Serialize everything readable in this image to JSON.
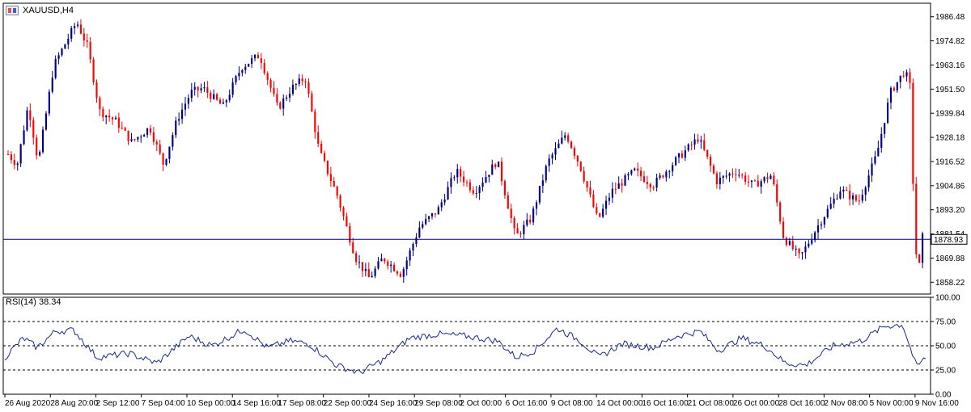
{
  "window": {
    "symbol_label": "XAUUSD,H4",
    "icon": "chart-window-icon"
  },
  "colors": {
    "bull": "#000080",
    "bear": "#ff0000",
    "rsi_line": "#1a2a8c",
    "level_line": "#000000",
    "frame": "#000000"
  },
  "chart_data": [
    {
      "type": "candlestick",
      "title": "XAUUSD,H4",
      "x_tick_labels": [
        "26 Aug 2020",
        "28 Aug 20:00",
        "2 Sep 12:00",
        "7 Sep 04:00",
        "10 Sep 00:00",
        "14 Sep 16:00",
        "17 Sep 08:00",
        "22 Sep 00:00",
        "24 Sep 16:00",
        "29 Sep 08:00",
        "2 Oct 00:00",
        "6 Oct 16:00",
        "9 Oct 08:00",
        "14 Oct 00:00",
        "16 Oct 16:00",
        "21 Oct 08:00",
        "26 Oct 00:00",
        "28 Oct 16:00",
        "2 Nov 08:00",
        "5 Nov 00:00",
        "9 Nov 16:00"
      ],
      "y_tick_labels": [
        "1986.48",
        "1974.82",
        "1963.16",
        "1951.50",
        "1939.84",
        "1928.18",
        "1916.52",
        "1904.86",
        "1893.20",
        "1881.54",
        "1869.88",
        "1858.22"
      ],
      "ylim": [
        1852.5,
        1993.0
      ],
      "current_price": 1878.93,
      "current_price_label": "1878.93",
      "anchors": [
        {
          "x": 0.0,
          "price": 1920
        },
        {
          "x": 0.01,
          "price": 1915
        },
        {
          "x": 0.022,
          "price": 1944
        },
        {
          "x": 0.033,
          "price": 1916
        },
        {
          "x": 0.05,
          "price": 1963
        },
        {
          "x": 0.075,
          "price": 1984
        },
        {
          "x": 0.087,
          "price": 1972
        },
        {
          "x": 0.1,
          "price": 1941
        },
        {
          "x": 0.118,
          "price": 1936
        },
        {
          "x": 0.135,
          "price": 1926
        },
        {
          "x": 0.155,
          "price": 1933
        },
        {
          "x": 0.17,
          "price": 1915
        },
        {
          "x": 0.185,
          "price": 1937
        },
        {
          "x": 0.2,
          "price": 1950
        },
        {
          "x": 0.213,
          "price": 1952
        },
        {
          "x": 0.235,
          "price": 1943
        },
        {
          "x": 0.255,
          "price": 1962
        },
        {
          "x": 0.275,
          "price": 1968
        },
        {
          "x": 0.295,
          "price": 1942
        },
        {
          "x": 0.31,
          "price": 1952
        },
        {
          "x": 0.325,
          "price": 1957
        },
        {
          "x": 0.34,
          "price": 1922
        },
        {
          "x": 0.36,
          "price": 1900
        },
        {
          "x": 0.38,
          "price": 1870
        },
        {
          "x": 0.395,
          "price": 1860
        },
        {
          "x": 0.41,
          "price": 1870
        },
        {
          "x": 0.43,
          "price": 1862
        },
        {
          "x": 0.45,
          "price": 1885
        },
        {
          "x": 0.47,
          "price": 1893
        },
        {
          "x": 0.49,
          "price": 1912
        },
        {
          "x": 0.51,
          "price": 1902
        },
        {
          "x": 0.535,
          "price": 1917
        },
        {
          "x": 0.555,
          "price": 1880
        },
        {
          "x": 0.572,
          "price": 1889
        },
        {
          "x": 0.59,
          "price": 1916
        },
        {
          "x": 0.61,
          "price": 1930
        },
        {
          "x": 0.625,
          "price": 1915
        },
        {
          "x": 0.645,
          "price": 1888
        },
        {
          "x": 0.66,
          "price": 1902
        },
        {
          "x": 0.685,
          "price": 1912
        },
        {
          "x": 0.705,
          "price": 1905
        },
        {
          "x": 0.73,
          "price": 1917
        },
        {
          "x": 0.755,
          "price": 1928
        },
        {
          "x": 0.775,
          "price": 1907
        },
        {
          "x": 0.795,
          "price": 1912
        },
        {
          "x": 0.815,
          "price": 1905
        },
        {
          "x": 0.835,
          "price": 1910
        },
        {
          "x": 0.848,
          "price": 1880
        },
        {
          "x": 0.866,
          "price": 1870
        },
        {
          "x": 0.885,
          "price": 1885
        },
        {
          "x": 0.91,
          "price": 1903
        },
        {
          "x": 0.93,
          "price": 1897
        },
        {
          "x": 0.95,
          "price": 1920
        },
        {
          "x": 0.965,
          "price": 1950
        },
        {
          "x": 0.98,
          "price": 1960
        },
        {
          "x": 0.986,
          "price": 1955
        },
        {
          "x": 0.992,
          "price": 1875
        },
        {
          "x": 0.996,
          "price": 1864
        },
        {
          "x": 1.0,
          "price": 1880
        }
      ],
      "indicator": {
        "name": "RSI(14)",
        "label": "RSI(14) 38.34",
        "last_value": 38.34,
        "y_tick_labels": [
          "100.00",
          "75.00",
          "50.00",
          "25.00",
          "0.00"
        ],
        "ylim": [
          0,
          100
        ],
        "levels": [
          75,
          50,
          25
        ]
      },
      "series_rsi_anchors": [
        {
          "x": 0.0,
          "rsi": 38
        },
        {
          "x": 0.02,
          "rsi": 58
        },
        {
          "x": 0.035,
          "rsi": 48
        },
        {
          "x": 0.055,
          "rsi": 65
        },
        {
          "x": 0.075,
          "rsi": 66
        },
        {
          "x": 0.1,
          "rsi": 38
        },
        {
          "x": 0.135,
          "rsi": 42
        },
        {
          "x": 0.165,
          "rsi": 32
        },
        {
          "x": 0.2,
          "rsi": 60
        },
        {
          "x": 0.225,
          "rsi": 50
        },
        {
          "x": 0.26,
          "rsi": 67
        },
        {
          "x": 0.285,
          "rsi": 48
        },
        {
          "x": 0.31,
          "rsi": 55
        },
        {
          "x": 0.33,
          "rsi": 52
        },
        {
          "x": 0.36,
          "rsi": 30
        },
        {
          "x": 0.385,
          "rsi": 22
        },
        {
          "x": 0.41,
          "rsi": 35
        },
        {
          "x": 0.44,
          "rsi": 58
        },
        {
          "x": 0.47,
          "rsi": 62
        },
        {
          "x": 0.5,
          "rsi": 60
        },
        {
          "x": 0.535,
          "rsi": 55
        },
        {
          "x": 0.555,
          "rsi": 38
        },
        {
          "x": 0.575,
          "rsi": 45
        },
        {
          "x": 0.6,
          "rsi": 68
        },
        {
          "x": 0.625,
          "rsi": 55
        },
        {
          "x": 0.645,
          "rsi": 38
        },
        {
          "x": 0.67,
          "rsi": 52
        },
        {
          "x": 0.705,
          "rsi": 48
        },
        {
          "x": 0.73,
          "rsi": 60
        },
        {
          "x": 0.755,
          "rsi": 65
        },
        {
          "x": 0.775,
          "rsi": 45
        },
        {
          "x": 0.8,
          "rsi": 58
        },
        {
          "x": 0.825,
          "rsi": 50
        },
        {
          "x": 0.848,
          "rsi": 32
        },
        {
          "x": 0.87,
          "rsi": 30
        },
        {
          "x": 0.9,
          "rsi": 50
        },
        {
          "x": 0.93,
          "rsi": 55
        },
        {
          "x": 0.955,
          "rsi": 70
        },
        {
          "x": 0.975,
          "rsi": 72
        },
        {
          "x": 0.99,
          "rsi": 28
        },
        {
          "x": 1.0,
          "rsi": 38
        }
      ]
    }
  ]
}
